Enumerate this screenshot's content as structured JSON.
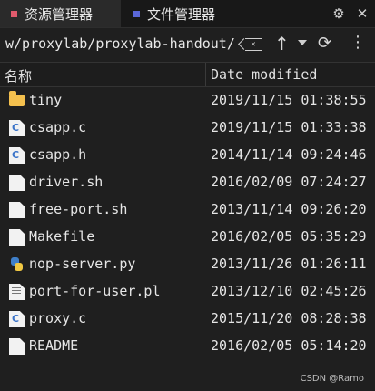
{
  "tabs": [
    {
      "label": "资源管理器",
      "color": "#e05a6c"
    },
    {
      "label": "文件管理器",
      "color": "#5b67d8"
    }
  ],
  "tab_actions": [
    {
      "icon": "settings-icon",
      "glyph": "⚙"
    },
    {
      "icon": "close-icon",
      "glyph": "✕"
    }
  ],
  "path": {
    "value": "w/proxylab/proxylab-handout/",
    "clear_glyph": "✕",
    "up_glyph": "↑",
    "refresh_glyph": "⟳",
    "more_glyph": "⋮"
  },
  "columns": {
    "name": "名称",
    "date": "Date modified"
  },
  "files": [
    {
      "name": "tiny",
      "date": "2019/11/15 01:38:55",
      "icon": "folder-icon"
    },
    {
      "name": "csapp.c",
      "date": "2019/11/15 01:33:38",
      "icon": "c-file-icon"
    },
    {
      "name": "csapp.h",
      "date": "2014/11/14 09:24:46",
      "icon": "c-file-icon"
    },
    {
      "name": "driver.sh",
      "date": "2016/02/09 07:24:27",
      "icon": "file-icon"
    },
    {
      "name": "free-port.sh",
      "date": "2013/11/14 09:26:20",
      "icon": "file-icon"
    },
    {
      "name": "Makefile",
      "date": "2016/02/05 05:35:29",
      "icon": "file-icon"
    },
    {
      "name": "nop-server.py",
      "date": "2013/11/26 01:26:11",
      "icon": "python-file-icon"
    },
    {
      "name": "port-for-user.pl",
      "date": "2013/12/10 02:45:26",
      "icon": "text-file-icon"
    },
    {
      "name": "proxy.c",
      "date": "2015/11/20 08:28:38",
      "icon": "c-file-icon"
    },
    {
      "name": "README",
      "date": "2016/02/05 05:14:20",
      "icon": "file-icon"
    }
  ],
  "watermark": "CSDN @Ramo"
}
